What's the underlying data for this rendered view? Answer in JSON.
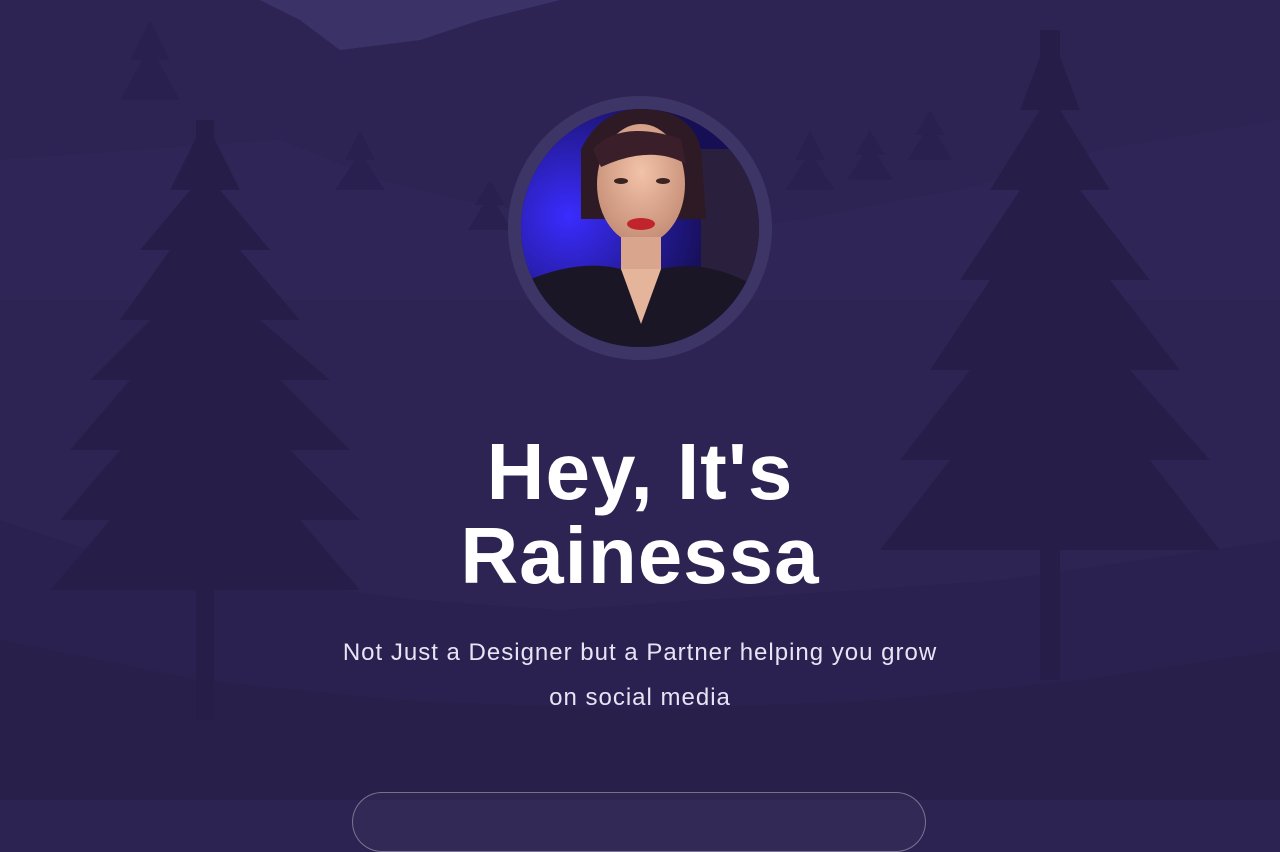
{
  "hero": {
    "headline_line1": "Hey, It's",
    "headline_line2": "Rainessa",
    "subtitle": "Not Just a Designer but a Partner helping you grow on social media"
  },
  "avatar": {
    "alt": "Rainessa profile photo"
  },
  "colors": {
    "background": "#2c2352",
    "tree_silhouette": "#251c44",
    "hill_light": "#3a3066",
    "ring": "#3d3566",
    "text": "#ffffff"
  }
}
